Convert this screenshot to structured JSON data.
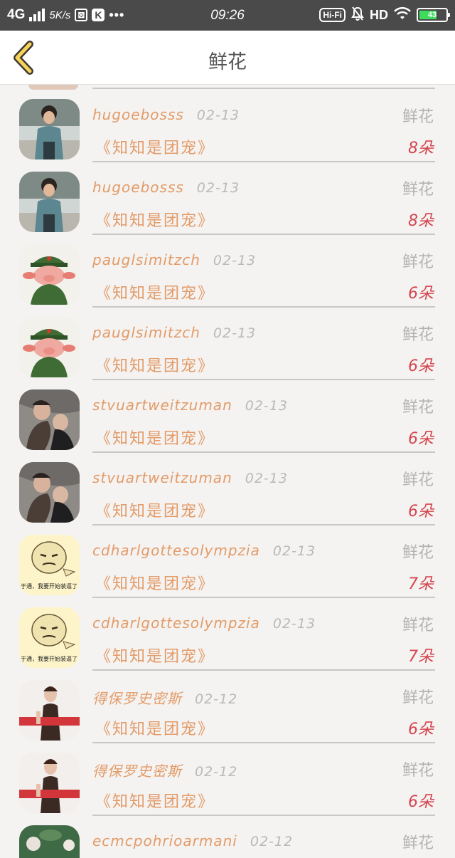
{
  "status_bar": {
    "network": "4G",
    "speed": "5K/s",
    "time": "09:26",
    "hifi": "Hi-Fi",
    "hd": "HD",
    "battery_level": "43"
  },
  "header": {
    "title": "鲜花",
    "back_icon": "chevron-left-icon"
  },
  "records": [
    {
      "user": "hugoebosss",
      "date": "02-13",
      "gift": "鲜花",
      "book": "《知知是团宠》",
      "count": "8朵",
      "avatar": "man-outdoor"
    },
    {
      "user": "hugoebosss",
      "date": "02-13",
      "gift": "鲜花",
      "book": "《知知是团宠》",
      "count": "8朵",
      "avatar": "man-outdoor"
    },
    {
      "user": "pauglsimitzch",
      "date": "02-13",
      "gift": "鲜花",
      "book": "《知知是团宠》",
      "count": "6朵",
      "avatar": "pig-soldier"
    },
    {
      "user": "pauglsimitzch",
      "date": "02-13",
      "gift": "鲜花",
      "book": "《知知是团宠》",
      "count": "6朵",
      "avatar": "pig-soldier"
    },
    {
      "user": "stvuartweitzuman",
      "date": "02-13",
      "gift": "鲜花",
      "book": "《知知是团宠》",
      "count": "6朵",
      "avatar": "couple-bed"
    },
    {
      "user": "stvuartweitzuman",
      "date": "02-13",
      "gift": "鲜花",
      "book": "《知知是团宠》",
      "count": "6朵",
      "avatar": "couple-bed"
    },
    {
      "user": "cdharlgottesolympzia",
      "date": "02-13",
      "gift": "鲜花",
      "book": "《知知是团宠》",
      "count": "7朵",
      "avatar": "meme-face",
      "avatar_caption": "于通，我要开始装逼了"
    },
    {
      "user": "cdharlgottesolympzia",
      "date": "02-13",
      "gift": "鲜花",
      "book": "《知知是团宠》",
      "count": "7朵",
      "avatar": "meme-face",
      "avatar_caption": "于通，我要开始装逼了"
    },
    {
      "user": "得保罗史密斯",
      "date": "02-12",
      "gift": "鲜花",
      "book": "《知知是团宠》",
      "count": "6朵",
      "avatar": "woman-red"
    },
    {
      "user": "得保罗史密斯",
      "date": "02-12",
      "gift": "鲜花",
      "book": "《知知是团宠》",
      "count": "6朵",
      "avatar": "woman-red"
    },
    {
      "user": "ecmcpohrioarmani",
      "date": "02-12",
      "gift": "鲜花",
      "book": "",
      "count": "",
      "avatar": "lotus"
    }
  ]
}
